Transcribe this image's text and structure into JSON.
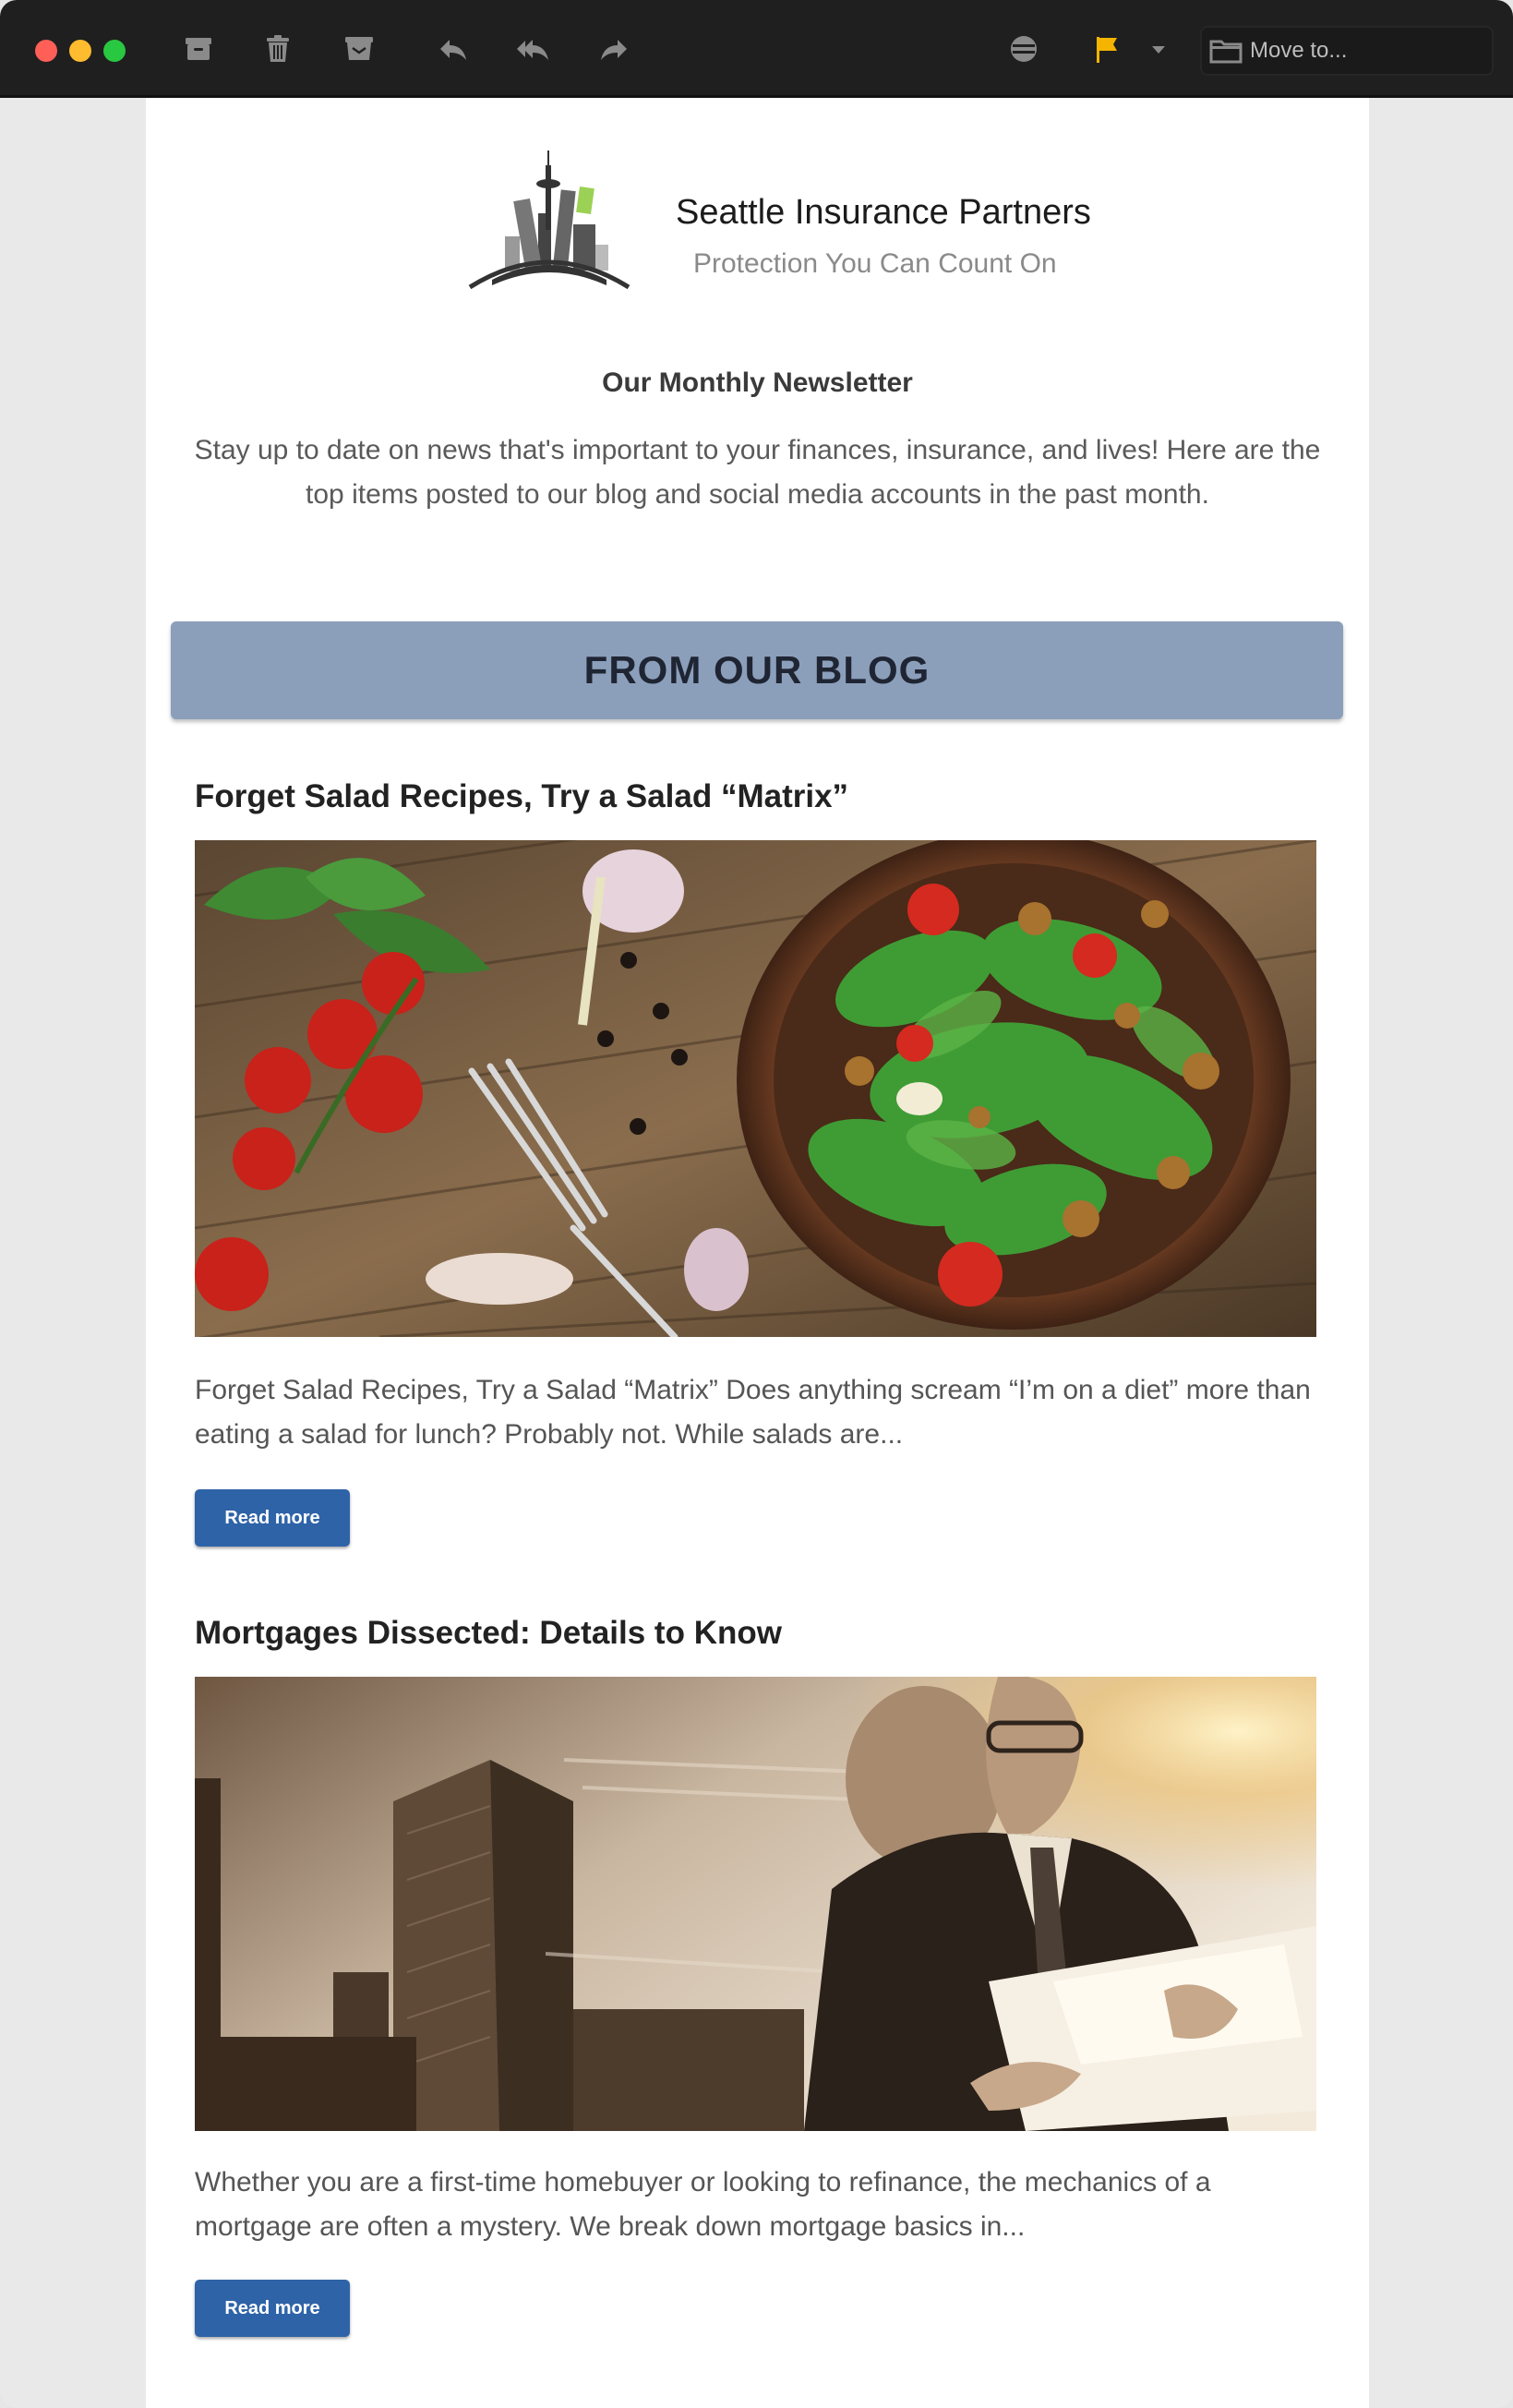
{
  "toolbar": {
    "buttons": [
      "archive-icon",
      "trash-icon",
      "junk-icon",
      "reply-icon",
      "reply-all-icon",
      "forward-icon",
      "globe-icon",
      "flag-icon",
      "chevron-down-icon"
    ],
    "flag_color": "#f5b400",
    "move_to_label": "Move to..."
  },
  "header": {
    "company_name": "Seattle Insurance Partners",
    "tagline": "Protection You Can Count On"
  },
  "newsletter": {
    "title": "Our Monthly Newsletter",
    "intro": "Stay up to date on news that's important to your finances, insurance, and lives! Here are the top items posted to our blog and social media accounts in the past month."
  },
  "blog": {
    "banner": "FROM OUR BLOG",
    "banner_color": "#8b9fbb",
    "posts": [
      {
        "title": "Forget Salad Recipes, Try a Salad “Matrix”",
        "excerpt": "Forget Salad Recipes, Try a Salad “Matrix” Does anything scream “I’m on a diet” more than eating a salad for lunch? Probably not. While salads are...",
        "button": "Read more"
      },
      {
        "title": "Mortgages Dissected: Details to Know",
        "excerpt": "Whether you are a first-time homebuyer or looking to refinance, the mechanics of a mortgage are often a mystery. We break down mortgage basics in...",
        "button": "Read more"
      }
    ]
  },
  "colors": {
    "button_blue": "#2e63a8"
  }
}
